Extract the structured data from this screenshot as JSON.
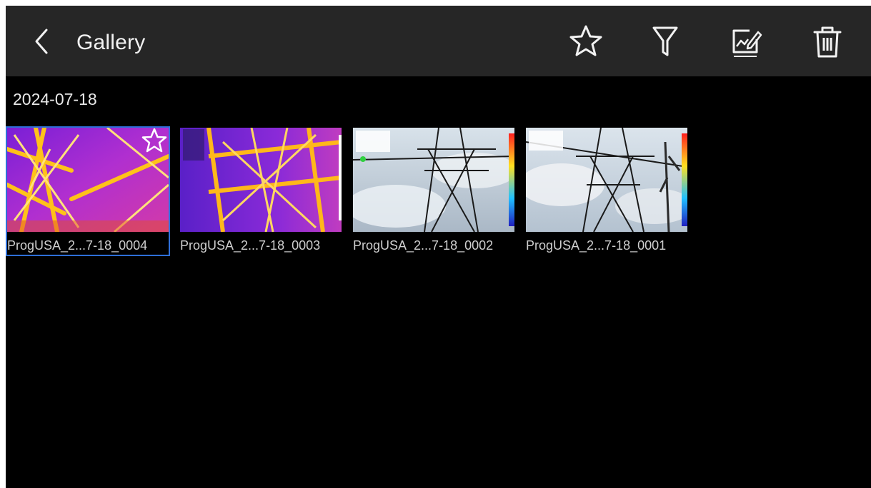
{
  "header": {
    "title": "Gallery",
    "back_icon": "chevron-left-icon",
    "actions": [
      {
        "name": "favorite",
        "icon": "star-outline-icon"
      },
      {
        "name": "filter",
        "icon": "funnel-icon"
      },
      {
        "name": "edit-report",
        "icon": "chart-edit-icon"
      },
      {
        "name": "delete",
        "icon": "trash-icon"
      }
    ]
  },
  "gallery": {
    "date": "2024-07-18",
    "items": [
      {
        "caption": "ProgUSA_2...7-18_0004",
        "type": "thermal",
        "selected": true,
        "favorite": true
      },
      {
        "caption": "ProgUSA_2...7-18_0003",
        "type": "thermal",
        "selected": false,
        "favorite": false
      },
      {
        "caption": "ProgUSA_2...7-18_0002",
        "type": "visual",
        "selected": false,
        "favorite": false
      },
      {
        "caption": "ProgUSA_2...7-18_0001",
        "type": "visual",
        "selected": false,
        "favorite": false
      }
    ]
  },
  "colors": {
    "background": "#000000",
    "topbar": "#262626",
    "selection": "#2e6fd8",
    "text": "#f2f2f2"
  }
}
